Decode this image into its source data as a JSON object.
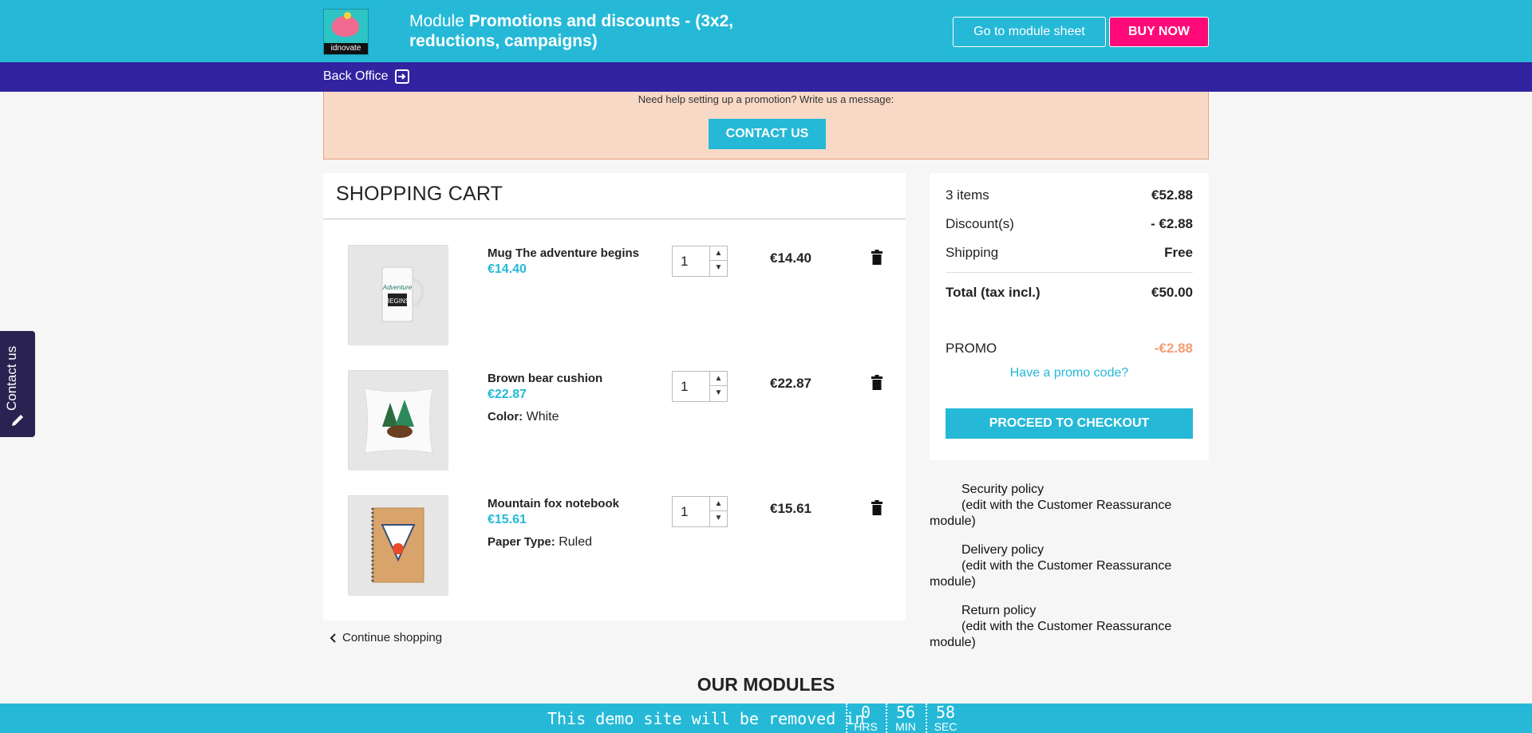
{
  "header": {
    "logo_text": "idnovate",
    "module_prefix": "Module ",
    "module_name": "Promotions and discounts - (3x2, reductions, campaigns)",
    "module_sheet_button": "Go to module sheet",
    "buy_button": "BUY NOW"
  },
  "backoffice": {
    "label": "Back Office"
  },
  "help": {
    "text": "Need help setting up a promotion? Write us a message:",
    "contact_button": "CONTACT US"
  },
  "cart": {
    "title": "SHOPPING CART",
    "items": [
      {
        "name": "Mug The adventure begins",
        "price": "€14.40",
        "attr_label": "",
        "attr_value": "",
        "qty": "1",
        "total": "€14.40"
      },
      {
        "name": "Brown bear cushion",
        "price": "€22.87",
        "attr_label": "Color:",
        "attr_value": "White",
        "qty": "1",
        "total": "€22.87"
      },
      {
        "name": "Mountain fox notebook",
        "price": "€15.61",
        "attr_label": "Paper Type:",
        "attr_value": "Ruled",
        "qty": "1",
        "total": "€15.61"
      }
    ],
    "continue": "Continue shopping"
  },
  "summary": {
    "items_label": "3 items",
    "items_value": "€52.88",
    "discount_label": "Discount(s)",
    "discount_value": "- €2.88",
    "shipping_label": "Shipping",
    "shipping_value": "Free",
    "total_label": "Total (tax incl.)",
    "total_value": "€50.00",
    "promo_label": "PROMO",
    "promo_value": "-€2.88",
    "promo_link": "Have a promo code?",
    "checkout_button": "PROCEED TO CHECKOUT"
  },
  "reassurance": [
    {
      "title": "Security policy",
      "note": "(edit with the Customer Reassurance",
      "note2": "module)"
    },
    {
      "title": "Delivery policy",
      "note": "(edit with the Customer Reassurance",
      "note2": "module)"
    },
    {
      "title": "Return policy",
      "note": "(edit with the Customer Reassurance",
      "note2": "module)"
    }
  ],
  "our_modules": "OUR MODULES",
  "demo": {
    "text": "This demo site will be removed in",
    "hours": "0",
    "hours_label": "HRS",
    "minutes": "56",
    "minutes_label": "MIN",
    "seconds": "58",
    "seconds_label": "SEC"
  },
  "side_tab": {
    "label": "Contact us"
  },
  "colors": {
    "primary": "#25b9d7",
    "backoffice": "#3223a0",
    "buy": "#ff0a78",
    "promo": "#f39d72"
  }
}
